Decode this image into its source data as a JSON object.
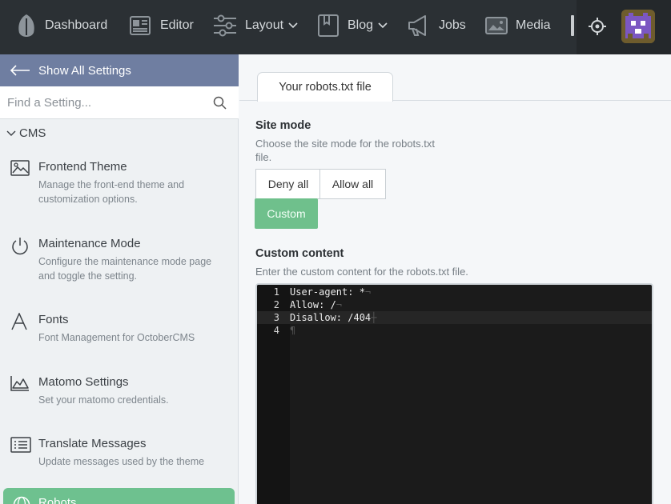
{
  "topnav": {
    "items": [
      {
        "label": "Dashboard",
        "icon": "leaf-icon"
      },
      {
        "label": "Editor",
        "icon": "editor-icon"
      },
      {
        "label": "Layout",
        "icon": "sliders-icon",
        "dropdown": true
      },
      {
        "label": "Blog",
        "icon": "book-icon",
        "dropdown": true
      },
      {
        "label": "Jobs",
        "icon": "megaphone-icon"
      },
      {
        "label": "Media",
        "icon": "media-icon"
      }
    ]
  },
  "sidebar": {
    "back_label": "Show All Settings",
    "search_placeholder": "Find a Setting...",
    "group_label": "CMS",
    "items": [
      {
        "title": "Frontend Theme",
        "description": "Manage the front-end theme and customization options.",
        "icon": "image-icon"
      },
      {
        "title": "Maintenance Mode",
        "description": "Configure the maintenance mode page and toggle the setting.",
        "icon": "power-icon"
      },
      {
        "title": "Fonts",
        "description": "Font Management for OctoberCMS",
        "icon": "font-icon"
      },
      {
        "title": "Matomo Settings",
        "description": "Set your matomo credentials.",
        "icon": "area-chart-icon"
      },
      {
        "title": "Translate Messages",
        "description": "Update messages used by the theme",
        "icon": "list-icon"
      }
    ],
    "active_item": {
      "title": "Robots",
      "icon": "globe-icon"
    }
  },
  "main": {
    "tab_label": "Your robots.txt file",
    "site_mode": {
      "label": "Site mode",
      "help": "Choose the site mode for the robots.txt file.",
      "options": [
        "Deny all",
        "Allow all",
        "Custom"
      ],
      "selected": "Custom"
    },
    "custom_content": {
      "label": "Custom content",
      "help": "Enter the custom content for the robots.txt file.",
      "lines": [
        {
          "number": "1",
          "text": "User-agent: *"
        },
        {
          "number": "2",
          "text": "Allow: /"
        },
        {
          "number": "3",
          "text": "Disallow: /404"
        },
        {
          "number": "4",
          "text": ""
        }
      ],
      "current_line": 3
    }
  },
  "colors": {
    "topbar": "#2b3034",
    "back_bar": "#6f7ea1",
    "accent_green": "#6fc08c",
    "editor_bg": "#1b1b1b"
  }
}
